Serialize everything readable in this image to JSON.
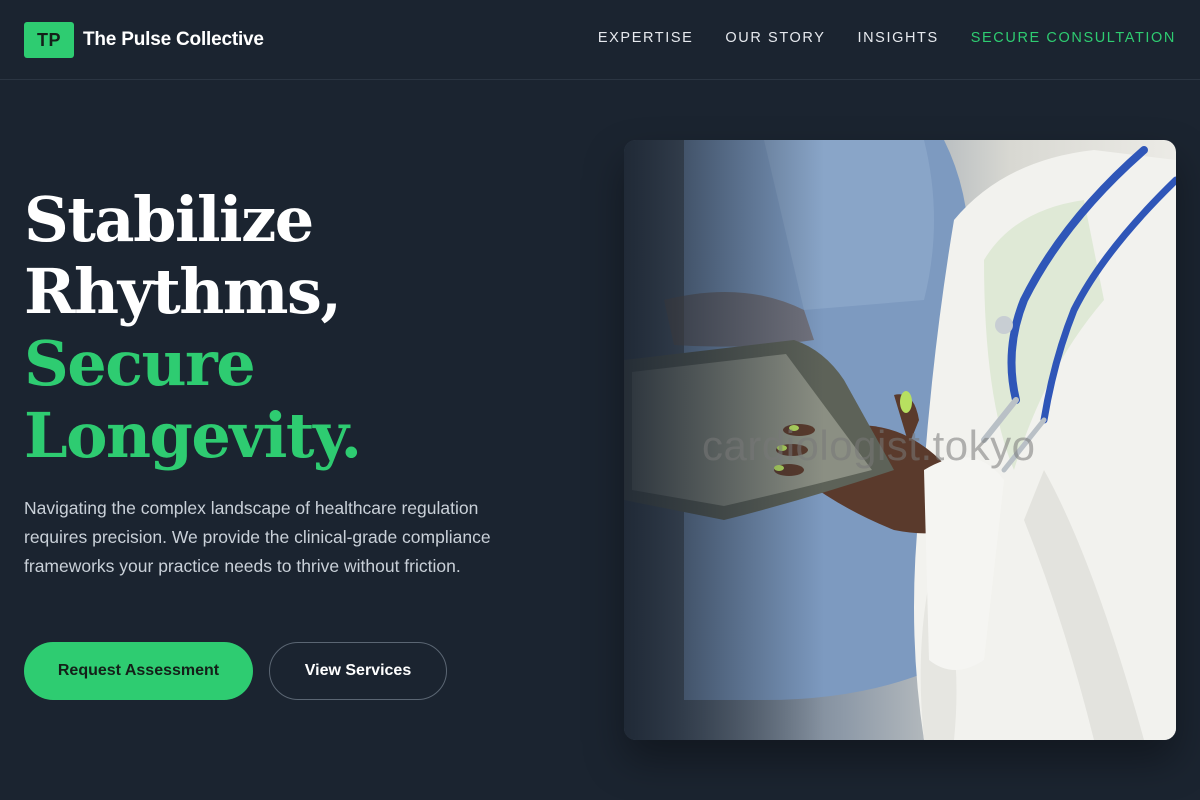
{
  "brand": {
    "badge": "TP",
    "name": "The Pulse Collective",
    "accent_color": "#2ecc71"
  },
  "nav": {
    "items": [
      {
        "label": "EXPERTISE"
      },
      {
        "label": "OUR STORY"
      },
      {
        "label": "INSIGHTS"
      },
      {
        "label": "SECURE CONSULTATION",
        "accent": true
      }
    ]
  },
  "hero": {
    "title_lines": [
      "Stabilize",
      "Rhythms,",
      "Secure",
      "Longevity."
    ],
    "description": "Navigating the complex landscape of healthcare regulation requires precision. We provide the clinical-grade compliance frameworks your practice needs to thrive without friction.",
    "primary_button": "Request Assessment",
    "secondary_button": "View Services",
    "image": {
      "subject": "doctor-with-stethoscope-holding-tablet",
      "watermark": "cardiologist.tokyo"
    }
  },
  "colors": {
    "background": "#1b2430",
    "accent": "#2ecc71",
    "text": "#ffffff",
    "muted_text": "#c9d0d8"
  }
}
